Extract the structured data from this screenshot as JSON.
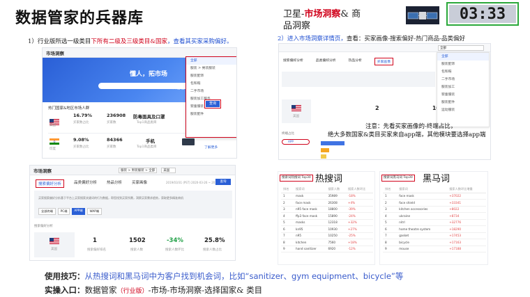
{
  "title": "数据管家的兵器库",
  "header_right": {
    "prefix": "卫星-",
    "highlight": "市场洞察",
    "suffix": "& 商品洞察"
  },
  "timer": "03:33",
  "step1": {
    "pre": "1）行业版所选一级类目",
    "red": "下所有二级及三级类目&国家",
    "blue": "，查看其买家采购偏好。"
  },
  "step2": {
    "pre": "2）进入市场洞察详情页，",
    "post": "查看：买家画像-搜索偏好-热门商品-品类偏好"
  },
  "shot_a": {
    "brand": "市场洞察",
    "hero_text": "懂人，拓市场",
    "hero_btn": "去看看",
    "dropdown": [
      "全部",
      "服装 > 男装服装",
      "服装配饰",
      "包和鞋",
      "二手市场",
      "服装加工服务",
      "婴童服装",
      "服装配件"
    ],
    "query_btn": "查询",
    "hot_title": "热门国家&地区市场人群",
    "rows": [
      {
        "country": "美国",
        "pct": "16.79%",
        "pct_label": "买家数占比",
        "num": "236908",
        "num_label": "买家数",
        "product": "防毒面具及口罩",
        "product_label": "Top1商品类目",
        "link": "了解更多"
      },
      {
        "country": "印度",
        "pct": "9.08%",
        "pct_label": "买家数占比",
        "num": "84366",
        "num_label": "买家数",
        "product": "手机",
        "product_label": "Top1商品类目",
        "link": "了解更多"
      }
    ]
  },
  "shot_b": {
    "brand": "市场洞察",
    "filter": "服装 > 男装服装 > 全部",
    "country_sel": "美国",
    "date": "2019/03/31 (PST) 2020-03-26 ~ 2020-04-21",
    "query_btn": "查询",
    "tabs": [
      "搜索偏好分析",
      "品类偏好分析",
      "热品分析",
      "买家画像"
    ],
    "desc": "买家搜索偏好分析基于平台上买家搜索关键词的行为数据，帮您找到买家所需，洞察买家需求趋势，获取更多精准商机",
    "chips": [
      "全部终端",
      "PC端",
      "APP端",
      "WAP端"
    ],
    "section": "搜索偏好分析",
    "country": "美国",
    "stats": [
      {
        "value": "1",
        "label": "搜索偏好排名",
        "color": "#222"
      },
      {
        "value": "1502",
        "label": "搜索人数",
        "color": "#222"
      },
      {
        "value": "-34%",
        "label": "搜索人数环比",
        "color": "#25a24a"
      },
      {
        "value": "25.8%",
        "label": "搜索人数占比",
        "color": "#222"
      }
    ]
  },
  "shot_c": {
    "search_value": "全部",
    "tabs": [
      "搜索偏好分析",
      "品类偏好分析",
      "热品分析",
      "买家画像"
    ],
    "active_tab": "买家画像",
    "country": "美国",
    "rank": "2",
    "pct": "10.06%",
    "terminal": "终端占比",
    "app_label": "APP",
    "side_list": [
      "全部",
      "服装配饰",
      "包和鞋",
      "二手市场",
      "服装加工",
      "婴童服装",
      "服装配件",
      "运动服装"
    ]
  },
  "annotation": [
    "注意：先看买家画像的-终端占比，",
    "绝大多数国家&类目买家来自app端，其他模块要选择app端"
  ],
  "hot": {
    "label": "热搜词",
    "badge": "搜索词热搜词 Top30",
    "headers": [
      "排名",
      "搜索词",
      "搜索人数",
      "搜索人数环比"
    ],
    "rows": [
      [
        "1",
        "mask",
        "35989",
        "-18%"
      ],
      [
        "2",
        "face mask",
        "26308",
        "+4%"
      ],
      [
        "3",
        "n95 face mask",
        "18800",
        "-39%"
      ],
      [
        "4",
        "ffp3 face mask",
        "15890",
        "-24%"
      ],
      [
        "5",
        "masks",
        "12318",
        "+32%"
      ],
      [
        "6",
        "kn95",
        "10930",
        "+27%"
      ],
      [
        "7",
        "n95",
        "10250",
        "-25%"
      ],
      [
        "8",
        "kitchen",
        "7560",
        "+18%"
      ],
      [
        "9",
        "hand sanitizer",
        "6920",
        "-12%"
      ]
    ]
  },
  "dark": {
    "label": "黑马词",
    "badge": "搜索词黑马词 Top30",
    "headers": [
      "排名",
      "搜索词",
      "搜索人数环比增量"
    ],
    "rows": [
      [
        "1",
        "face mask",
        "+37022"
      ],
      [
        "2",
        "face shield",
        "+33341"
      ],
      [
        "3",
        "kitchen accessories",
        "+8022"
      ],
      [
        "4",
        "ukraine",
        "+8734"
      ],
      [
        "5",
        "nitrl",
        "+32776"
      ],
      [
        "6",
        "home theatre system",
        "+18290"
      ],
      [
        "7",
        "gasket",
        "+17453"
      ],
      [
        "8",
        "bicycle",
        "+17163"
      ],
      [
        "9",
        "mouse",
        "+17188"
      ]
    ]
  },
  "tip": {
    "lead": "使用技巧：",
    "body": "从热搜词和黑马词中为客户找到机会词，比如“sanitizer、gym equipment、bicycle”等"
  },
  "entry": {
    "lead": "实操入口：",
    "pre": "数据管家",
    "red": "（行业版）",
    "post": "-市场-市场洞察-选择国家& 类目"
  },
  "colors": {
    "accent_red": "#d0021b",
    "brand_blue": "#2a5fd6",
    "tip_blue": "#3a5ccc",
    "timer_border": "#2aa83a"
  }
}
